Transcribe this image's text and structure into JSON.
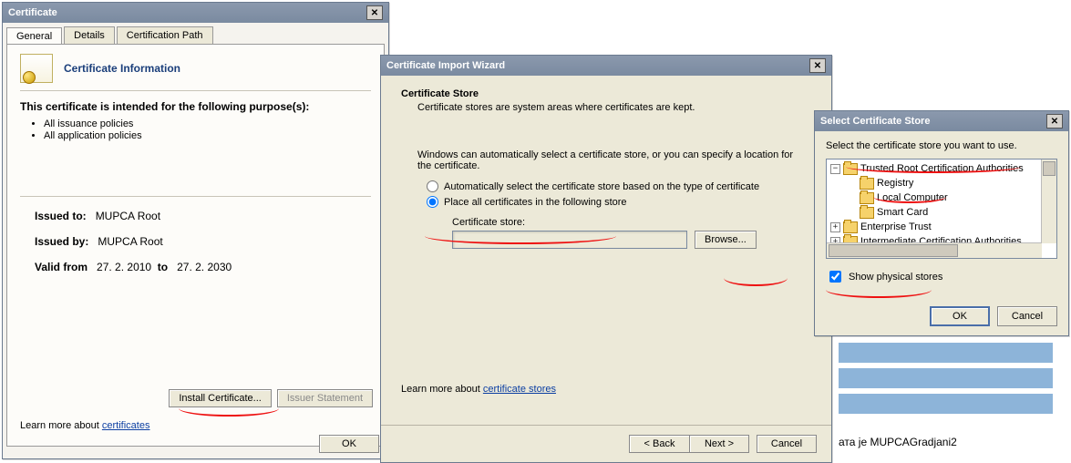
{
  "background": {
    "text_behind": "ата је MUPCAGradjani2"
  },
  "cert_window": {
    "title": "Certificate",
    "tabs": [
      "General",
      "Details",
      "Certification Path"
    ],
    "active_tab": 0,
    "section_title": "Certificate Information",
    "purpose_heading": "This certificate is intended for the following purpose(s):",
    "purposes": [
      "All issuance policies",
      "All application policies"
    ],
    "issued_to_label": "Issued to:",
    "issued_to_value": "MUPCA Root",
    "issued_by_label": "Issued by:",
    "issued_by_value": "MUPCA Root",
    "valid_from_label": "Valid from",
    "valid_from_value": "27. 2. 2010",
    "valid_to_label": "to",
    "valid_to_value": "27. 2. 2030",
    "install_btn": "Install Certificate...",
    "issuer_btn": "Issuer Statement",
    "learn_prefix": "Learn more about ",
    "learn_link": "certificates",
    "ok": "OK"
  },
  "wizard": {
    "title": "Certificate Import Wizard",
    "heading": "Certificate Store",
    "desc": "Certificate stores are system areas where certificates are kept.",
    "body_text": "Windows can automatically select a certificate store, or you can specify a location for the certificate.",
    "radio_auto": "Automatically select the certificate store based on the type of certificate",
    "radio_place": "Place all certificates in the following store",
    "radio_selected": "place",
    "store_label": "Certificate store:",
    "store_value": "",
    "browse_btn": "Browse...",
    "learn_prefix": "Learn more about ",
    "learn_link": "certificate stores",
    "back": "< Back",
    "next": "Next >",
    "cancel": "Cancel"
  },
  "select_store": {
    "title": "Select Certificate Store",
    "prompt": "Select the certificate store you want to use.",
    "tree": {
      "root": "Trusted Root Certification Authorities",
      "children": [
        "Registry",
        "Local Computer",
        "Smart Card"
      ],
      "siblings": [
        "Enterprise Trust",
        "Intermediate Certification Authorities"
      ]
    },
    "show_physical_label": "Show physical stores",
    "show_physical_checked": true,
    "ok": "OK",
    "cancel": "Cancel"
  }
}
